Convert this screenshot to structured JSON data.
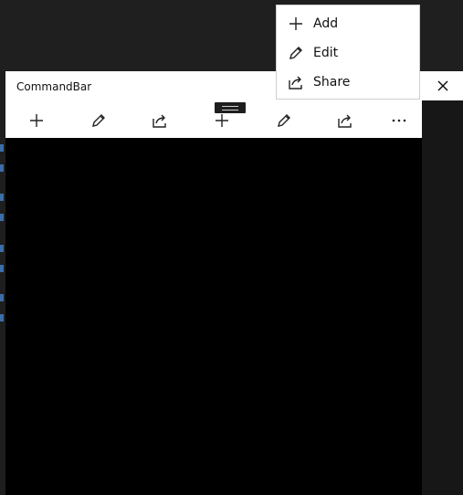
{
  "window": {
    "title": "CommandBar"
  },
  "commandbar": {
    "primary": [
      {
        "name": "add",
        "icon": "plus-icon"
      },
      {
        "name": "edit",
        "icon": "pencil-icon"
      },
      {
        "name": "share",
        "icon": "share-icon"
      },
      {
        "name": "add",
        "icon": "plus-icon"
      },
      {
        "name": "edit",
        "icon": "pencil-icon"
      },
      {
        "name": "share",
        "icon": "share-icon"
      },
      {
        "name": "more",
        "icon": "more-dots-icon"
      }
    ]
  },
  "flyout": {
    "items": [
      {
        "label": "Add",
        "icon": "plus-icon"
      },
      {
        "label": "Edit",
        "icon": "pencil-icon"
      },
      {
        "label": "Share",
        "icon": "share-icon"
      }
    ]
  },
  "colors": {
    "surface": "#ffffff",
    "background": "#000000",
    "text": "#111111"
  }
}
